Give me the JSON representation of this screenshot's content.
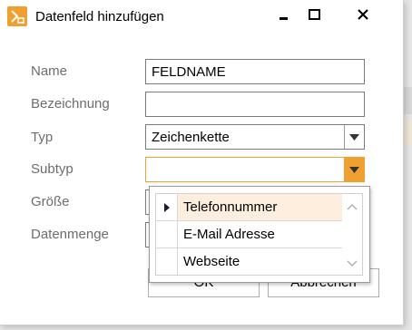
{
  "window": {
    "title": "Datenfeld hinzufügen",
    "accent_color": "#f0a030",
    "icons": {
      "app": "app-logo-icon",
      "minimize": "minimize-icon",
      "maximize": "maximize-icon",
      "close": "close-icon"
    }
  },
  "form": {
    "name_label": "Name",
    "name_value": "FELDNAME",
    "bezeichnung_label": "Bezeichnung",
    "bezeichnung_value": "",
    "typ_label": "Typ",
    "typ_value": "Zeichenkette",
    "subtyp_label": "Subtyp",
    "subtyp_value": "",
    "groesse_label": "Größe",
    "datenmenge_label": "Datenmenge"
  },
  "subtyp_dropdown": {
    "options": [
      "Telefonnummer",
      "E-Mail Adresse",
      "Webseite"
    ],
    "selected_index": 0
  },
  "buttons": {
    "ok": "OK",
    "cancel": "Abbrechen"
  }
}
